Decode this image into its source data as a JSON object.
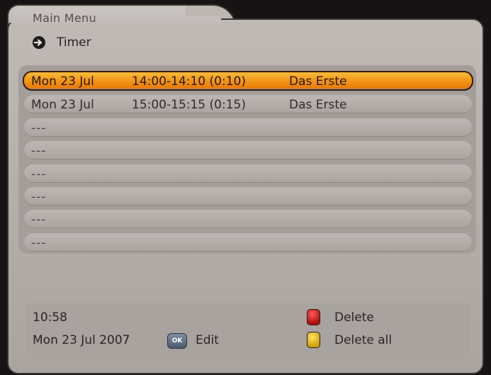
{
  "header": {
    "title": "Main Menu",
    "subtitle": "Timer",
    "subtitle_icon": "timer-arrow-icon"
  },
  "timers": [
    {
      "date": "Mon  23 Jul",
      "time": "14:00-14:10 (0:10)",
      "channel": "Das Erste",
      "selected": true
    },
    {
      "date": "Mon  23 Jul",
      "time": "15:00-15:15 (0:15)",
      "channel": "Das Erste",
      "selected": false
    },
    {
      "empty": "---"
    },
    {
      "empty": "---"
    },
    {
      "empty": "---"
    },
    {
      "empty": "---"
    },
    {
      "empty": "---"
    },
    {
      "empty": "---"
    }
  ],
  "footer": {
    "clock": "10:58",
    "date": "Mon 23 Jul 2007",
    "ok_badge": "OK",
    "ok_label": "Edit",
    "red_label": "Delete",
    "yellow_label": "Delete all"
  },
  "colors": {
    "highlight": "#f29a18",
    "panel": "#bdb7b3",
    "red_key": "#c81414",
    "yellow_key": "#e6b413"
  }
}
